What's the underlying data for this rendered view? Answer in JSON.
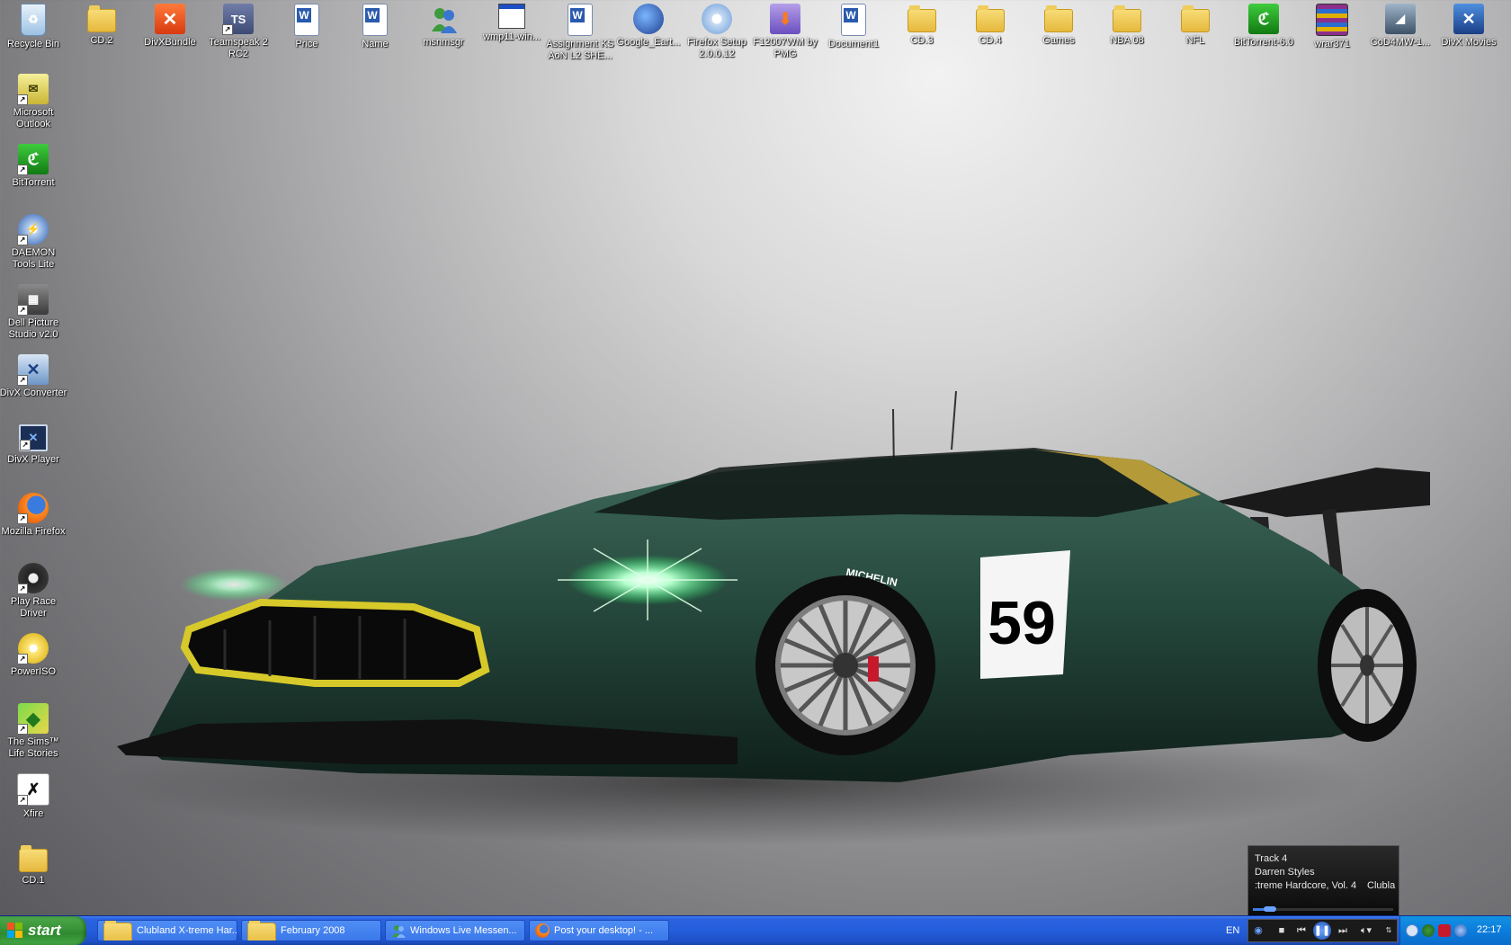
{
  "desktop": {
    "top_icons": [
      {
        "name": "recycle-bin-icon",
        "label": "Recycle Bin"
      },
      {
        "name": "folder-icon",
        "label": "CD.2"
      },
      {
        "name": "divx-icon",
        "label": "DivXBundle"
      },
      {
        "name": "teamspeak-icon",
        "label": "Teamspeak 2 RC2"
      },
      {
        "name": "word-doc-icon",
        "label": "Price"
      },
      {
        "name": "word-doc-icon",
        "label": "Name"
      },
      {
        "name": "messenger-icon",
        "label": "msnmsgr"
      },
      {
        "name": "window-icon",
        "label": "wmp11-win..."
      },
      {
        "name": "word-doc-icon",
        "label": "Assignment KS AoN L2 SHE..."
      },
      {
        "name": "google-earth-icon",
        "label": "Google_Eart..."
      },
      {
        "name": "firefox-setup-icon",
        "label": "Firefox Setup 2.0.0.12"
      },
      {
        "name": "installer-icon",
        "label": "F12007WM by PMG"
      },
      {
        "name": "word-doc-icon",
        "label": "Document1"
      },
      {
        "name": "folder-icon",
        "label": "CD.3"
      },
      {
        "name": "folder-icon",
        "label": "CD.4"
      },
      {
        "name": "folder-icon",
        "label": "Games"
      },
      {
        "name": "folder-icon",
        "label": "NBA 08"
      },
      {
        "name": "folder-icon",
        "label": "NFL"
      },
      {
        "name": "bittorrent-icon",
        "label": "BitTorrent-6.0"
      },
      {
        "name": "winrar-icon",
        "label": "wrar371"
      },
      {
        "name": "cod4-icon",
        "label": "CoD4MW-1..."
      },
      {
        "name": "divx-movies-icon",
        "label": "DivX Movies"
      }
    ],
    "left_icons": [
      {
        "name": "outlook-icon",
        "label": "Microsoft Outlook"
      },
      {
        "name": "bittorrent-icon",
        "label": "BitTorrent"
      },
      {
        "name": "daemon-tools-icon",
        "label": "DAEMON Tools Lite"
      },
      {
        "name": "dell-picture-studio-icon",
        "label": "Dell Picture Studio v2.0"
      },
      {
        "name": "divx-converter-icon",
        "label": "DivX Converter"
      },
      {
        "name": "divx-player-icon",
        "label": "DivX Player"
      },
      {
        "name": "firefox-icon",
        "label": "Mozilla Firefox"
      },
      {
        "name": "race-driver-icon",
        "label": "Play Race Driver"
      },
      {
        "name": "poweriso-icon",
        "label": "PowerISO"
      },
      {
        "name": "sims-icon",
        "label": "The Sims™ Life Stories"
      },
      {
        "name": "xfire-icon",
        "label": "Xfire"
      },
      {
        "name": "folder-icon",
        "label": "CD.1"
      }
    ],
    "wallpaper": {
      "car_number": "59",
      "brand": "MICHELIN"
    }
  },
  "media_popup": {
    "line1": "Track 4",
    "line2": "Darren Styles",
    "line3": ":treme Hardcore, Vol. 4",
    "line3b": "Clubla",
    "progress": 0.12
  },
  "taskbar": {
    "start_label": "start",
    "buttons": [
      {
        "label": "Clubland X-treme Har...",
        "icon": "folder-icon"
      },
      {
        "label": "February 2008",
        "icon": "folder-icon"
      },
      {
        "label": "Windows Live Messen...",
        "icon": "messenger-icon"
      },
      {
        "label": "Post your desktop! - ...",
        "icon": "firefox-icon"
      }
    ],
    "language": "EN",
    "clock": "22:17"
  },
  "colors": {
    "taskbar": "#245edb",
    "start": "#3c953a",
    "tray": "#0c7ddc"
  }
}
